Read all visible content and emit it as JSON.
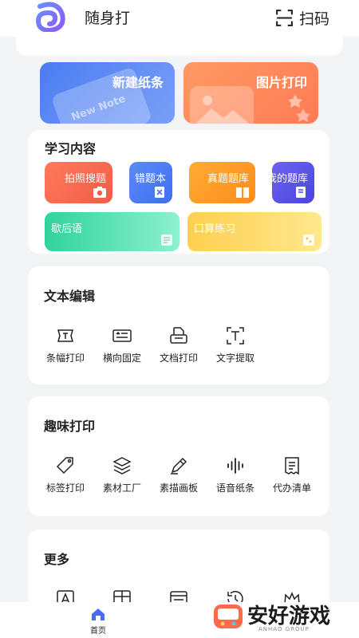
{
  "app": {
    "title": "随身打",
    "scan_label": "扫码"
  },
  "actions": {
    "new_note": "新建纸条",
    "new_note_deco": "New Note",
    "image_print": "图片打印"
  },
  "study": {
    "title": "学习内容",
    "chips": [
      "拍照搜题",
      "错题本",
      "真题题库",
      "我的题库",
      "歇后语",
      "口算练习"
    ]
  },
  "text_edit": {
    "title": "文本编辑",
    "items": [
      "条幅打印",
      "横向固定",
      "文档打印",
      "文字提取"
    ]
  },
  "fun_print": {
    "title": "趣味打印",
    "items": [
      "标签打印",
      "素材工厂",
      "素描画板",
      "语音纸条",
      "代办清单"
    ]
  },
  "more": {
    "title": "更多"
  },
  "nav": {
    "home": "首页"
  },
  "watermark": {
    "text": "安好游戏",
    "sub": "ANHAO GROUP"
  },
  "colors": {
    "primary_blue": "#4a7cf2",
    "orange": "#ff7a55",
    "accent_home": "#4a6cf2"
  }
}
